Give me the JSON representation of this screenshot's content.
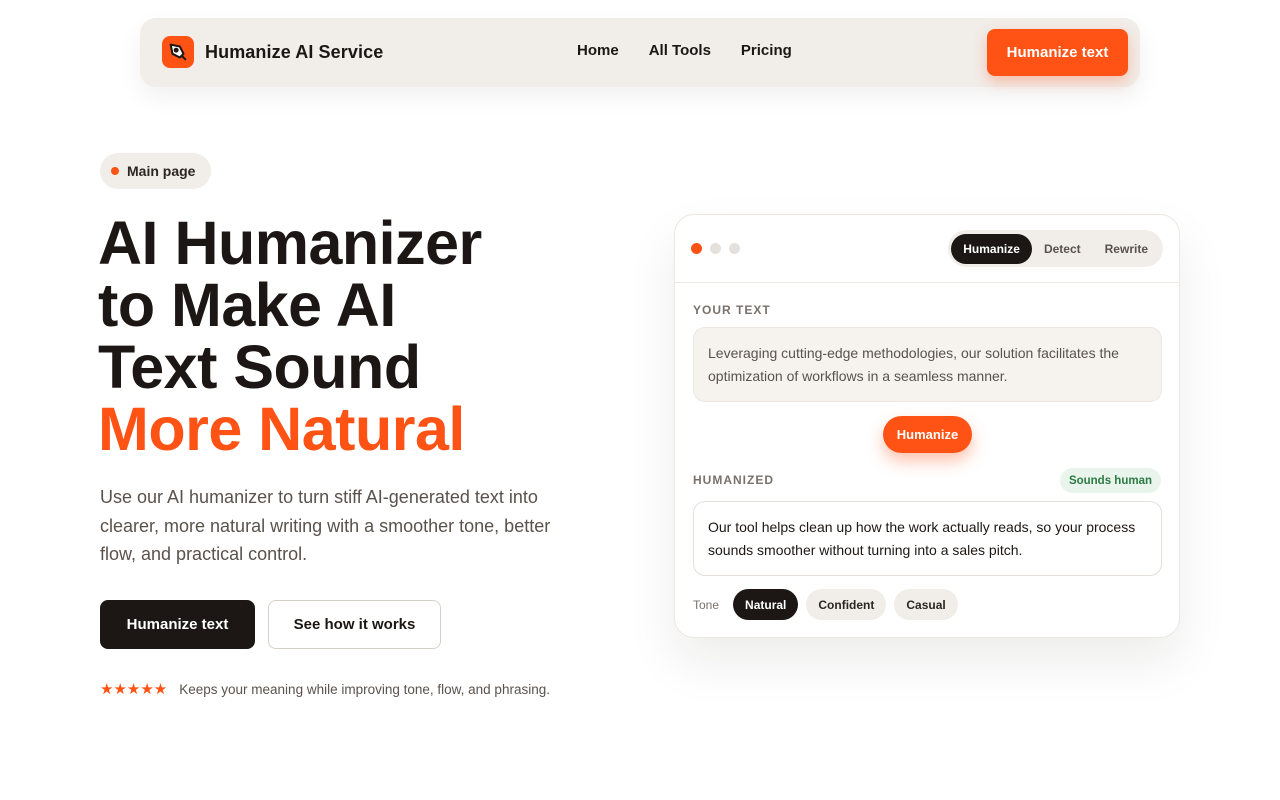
{
  "nav": {
    "brand": "Humanize AI Service",
    "links": [
      "Home",
      "All Tools",
      "Pricing"
    ],
    "cta": "Humanize text",
    "logo_icon": "pen-nib-icon"
  },
  "hero": {
    "badge": "Main page",
    "headline_lines": [
      "AI Humanizer",
      "to Make AI",
      "Text Sound"
    ],
    "headline_accent": "More Natural",
    "lede": "Use our AI humanizer to turn stiff AI-generated text into clearer, more natural writing with a smoother tone, better flow, and practical control.",
    "primary_button": "Humanize text",
    "secondary_button": "See how it works",
    "stars": "★★★★★",
    "rating_text": "Keeps your meaning while improving tone, flow, and phrasing."
  },
  "card": {
    "tabs": [
      "Humanize",
      "Detect",
      "Rewrite"
    ],
    "active_tab": "Humanize",
    "input_label": "YOUR TEXT",
    "input_text": "Leveraging cutting-edge methodologies, our solution facilitates the optimization of workflows in a seamless manner.",
    "action_button": "Humanize",
    "output_label": "HUMANIZED",
    "output_badge": "Sounds human",
    "output_text": "Our tool helps clean up how the work actually reads, so your process sounds smoother without turning into a sales pitch.",
    "tone_label": "Tone",
    "tones": [
      "Natural",
      "Confident",
      "Casual"
    ],
    "active_tone": "Natural"
  },
  "colors": {
    "accent": "#ff5316",
    "dark": "#1c1714",
    "muted_bg": "#f1ede9",
    "success": "#2c7a43"
  }
}
